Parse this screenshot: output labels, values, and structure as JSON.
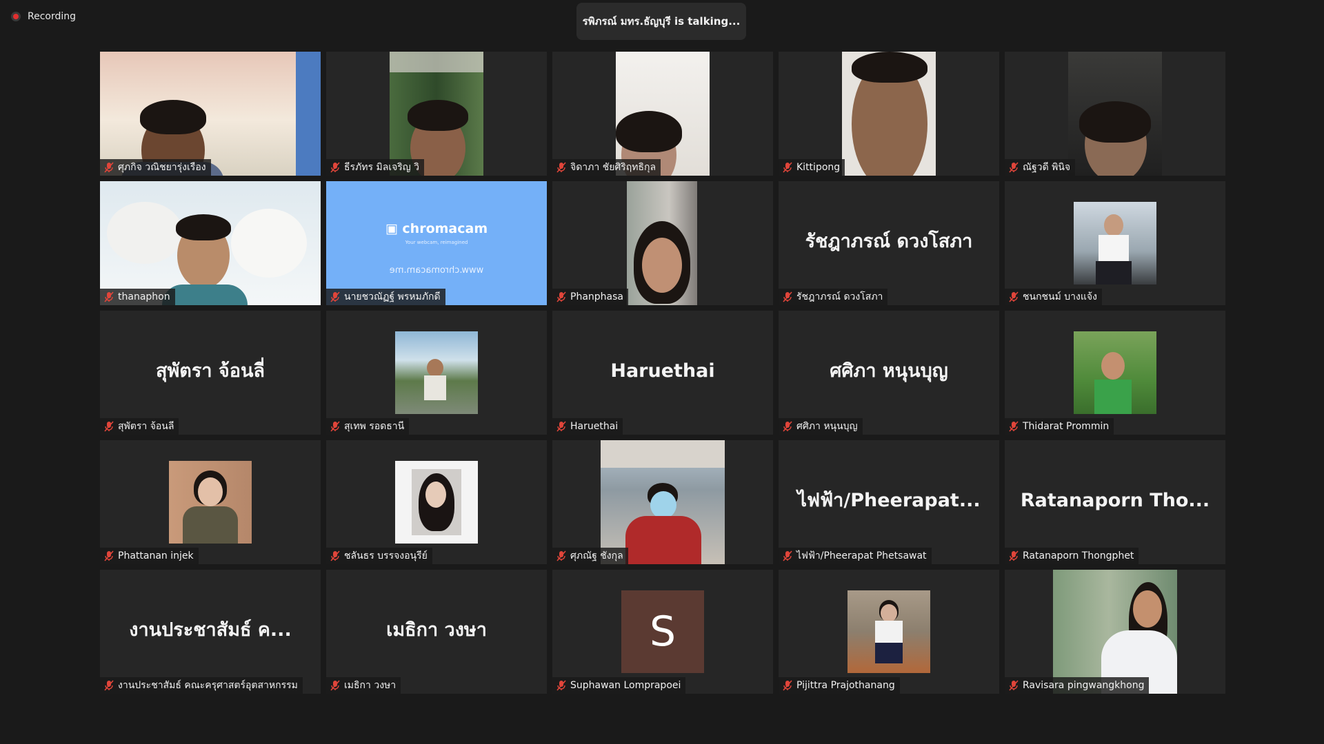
{
  "recording": {
    "label": "Recording"
  },
  "talking_banner": {
    "text": "รพิภรณ์ มทร.ธัญบุรี is  talking..."
  },
  "participants": [
    {
      "name": "ศุภกิจ วณิชยารุ่งเรือง"
    },
    {
      "name": "ธีรภัทร มิลเจริญ วิ"
    },
    {
      "name": "จิดาภา ชัยศิริฤทธิกุล"
    },
    {
      "name": "Kittipong"
    },
    {
      "name": "ณัฐวดี พินิจ"
    },
    {
      "name": "thanaphon"
    },
    {
      "name": "นายชวณัฏฐ์ พรหมภักดี",
      "video_text": {
        "logo": "chromacam",
        "sub": "Your webcam, reimagined",
        "url": "www.chromacam.me"
      }
    },
    {
      "name": "Phanphasa"
    },
    {
      "name": "รัชฎาภรณ์ ดวงโสภา",
      "display_name": "รัชฎาภรณ์ ดวงโสภา"
    },
    {
      "name": "ชนกชนม์ บางแจ้ง"
    },
    {
      "name": "สุพัตรา จ้อนลี",
      "display_name": "สุพัตรา จ้อนลี่"
    },
    {
      "name": "สุเทพ รอดธานี"
    },
    {
      "name": "Haruethai",
      "display_name": "Haruethai"
    },
    {
      "name": "ศศิภา หนุนบุญ",
      "display_name": "ศศิภา หนุนบุญ"
    },
    {
      "name": "Thidarat Prommin"
    },
    {
      "name": "Phattanan injek"
    },
    {
      "name": "ชลันธร บรรจงอนุรีย์"
    },
    {
      "name": "ศุภณัฐ ชังกุล"
    },
    {
      "name": "ไฟฟ้า/Pheerapat Phetsawat",
      "display_name": "ไฟฟ้า/Pheerapat..."
    },
    {
      "name": "Ratanaporn Thongphet",
      "display_name": "Ratanaporn  Tho..."
    },
    {
      "name": "งานประชาสัมธ์ คณะครุศาสตร์อุตสาหกรรม",
      "display_name": "งานประชาสัมธ์ ค..."
    },
    {
      "name": "เมธิกา  วงษา",
      "display_name": "เมธิกา  วงษา"
    },
    {
      "name": "Suphawan Lomprapoei",
      "avatar_letter": "S"
    },
    {
      "name": "Pijittra Prajothanang"
    },
    {
      "name": "Ravisara pingwangkhong"
    }
  ],
  "icons": {
    "mic_muted": "microphone-slash-icon",
    "recording": "record-dot-icon"
  },
  "colors": {
    "mic_muted": "#e0453a",
    "background": "#1a1a1a",
    "tile": "#262626",
    "chromacam_bg": "#74b0f8"
  }
}
